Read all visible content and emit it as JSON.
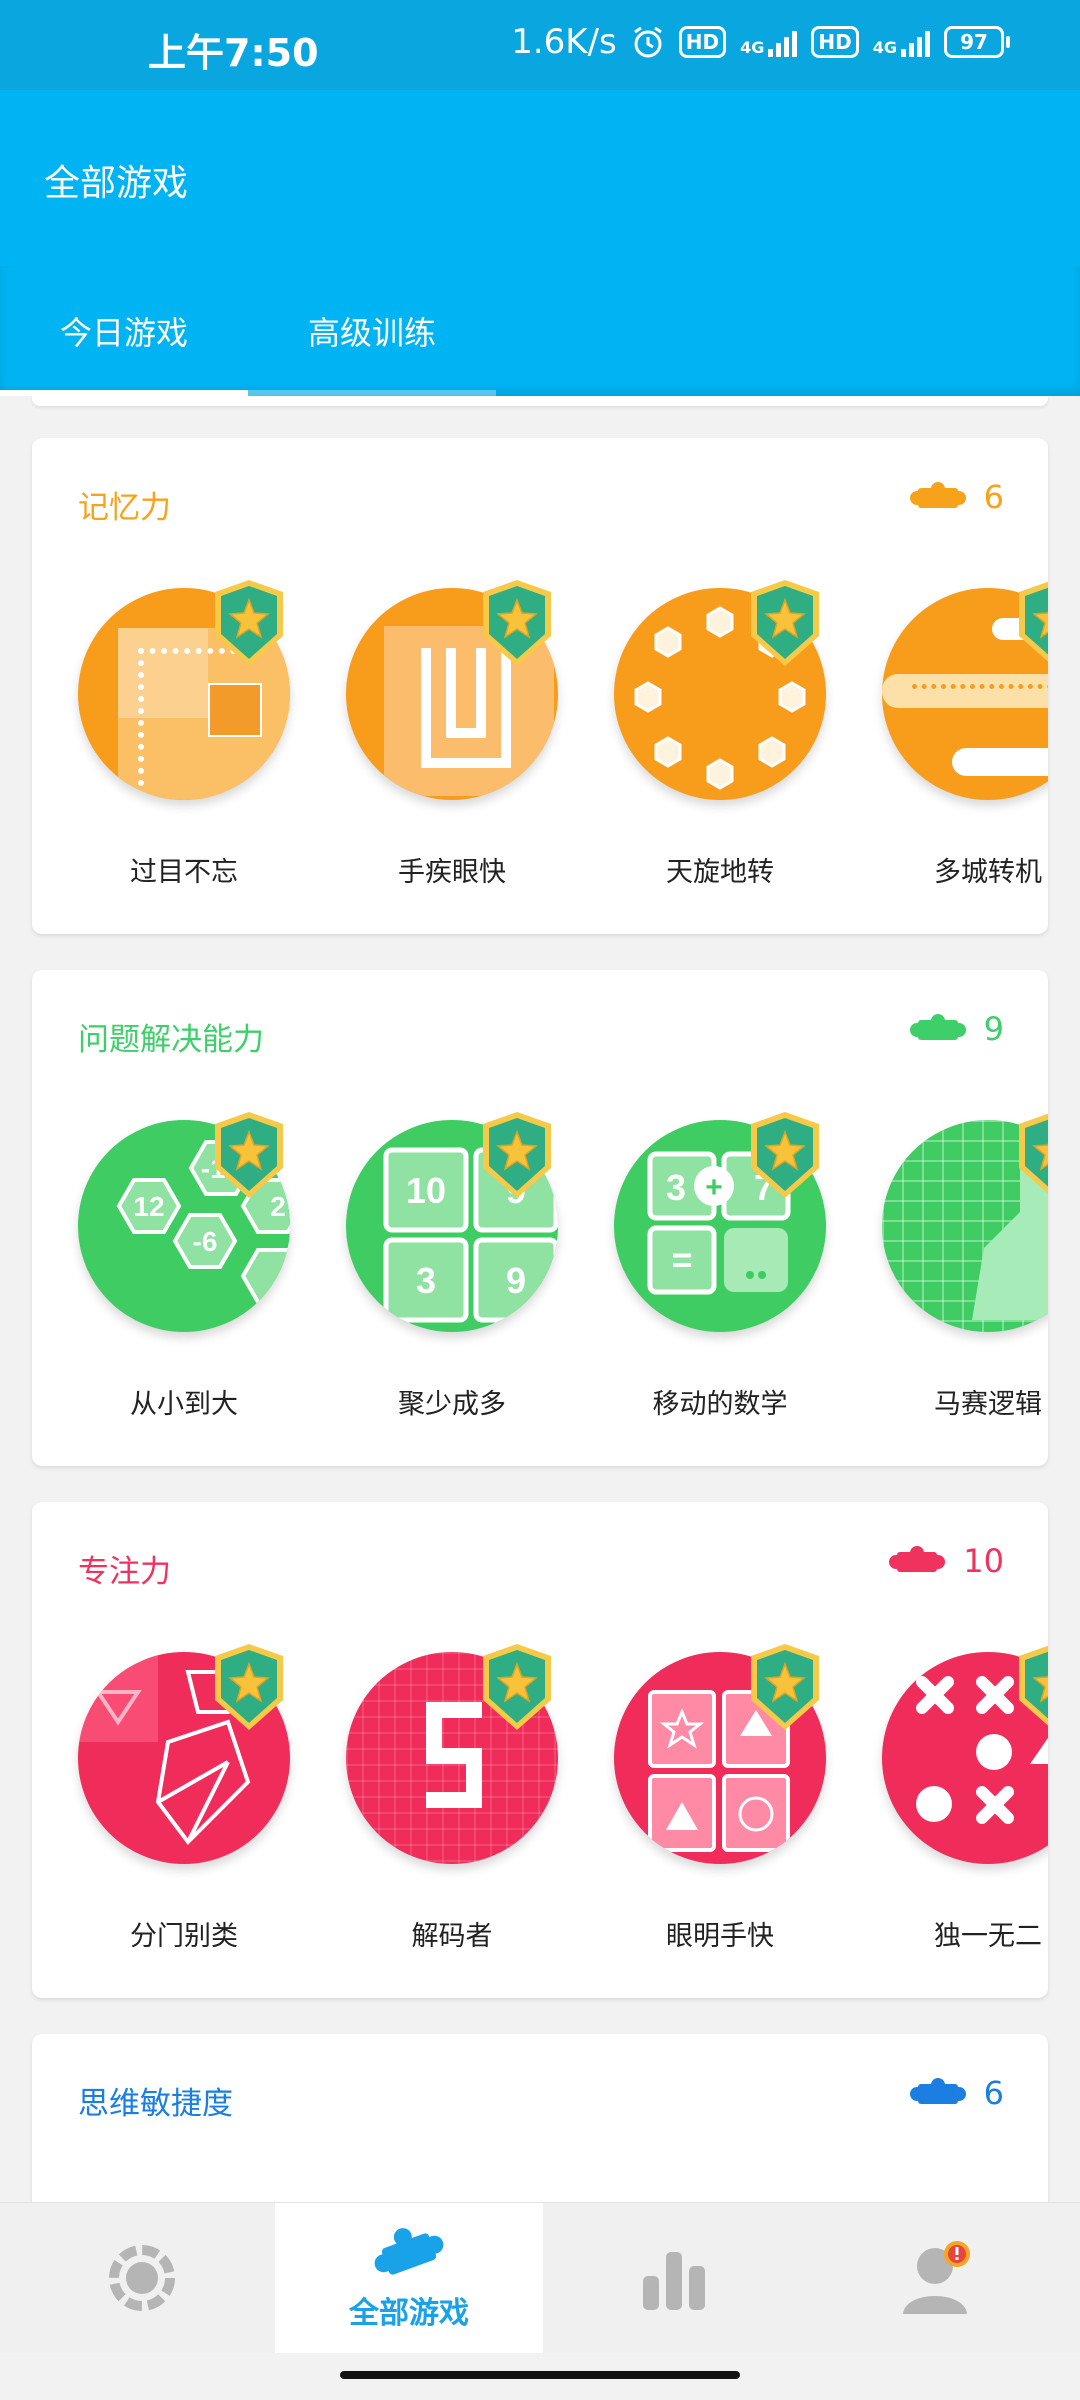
{
  "status_bar": {
    "time": "上午7:50",
    "speed": "1.6K/s",
    "hd1": "HD",
    "net1": "4G",
    "hd2": "HD",
    "net2": "4G",
    "battery": "97"
  },
  "appbar": {
    "title": "全部游戏"
  },
  "tabs": [
    {
      "label": "今日游戏",
      "active": true
    },
    {
      "label": "高级训练",
      "active": false
    }
  ],
  "sections": [
    {
      "title": "记忆力",
      "count": "6",
      "color": "#f7a21b",
      "games": [
        {
          "label": "过目不忘",
          "icon": "grid-path-icon"
        },
        {
          "label": "手疾眼快",
          "icon": "u-shape-grid-icon"
        },
        {
          "label": "天旋地转",
          "icon": "hexagon-ring-icon"
        },
        {
          "label": "多城转机",
          "icon": "airplane-clouds-icon"
        }
      ]
    },
    {
      "title": "问题解决能力",
      "count": "9",
      "color": "#3ecf6a",
      "games": [
        {
          "label": "从小到大",
          "icon": "number-hexagons-icon",
          "nums": [
            "12",
            "-12",
            "-6",
            "2"
          ]
        },
        {
          "label": "聚少成多",
          "icon": "number-tiles-icon",
          "nums": [
            "10",
            "3",
            "9",
            "9"
          ]
        },
        {
          "label": "移动的数学",
          "icon": "math-tiles-icon",
          "nums": [
            "3",
            "+",
            "7",
            "="
          ]
        },
        {
          "label": "马赛逻辑",
          "icon": "mosaic-grid-icon"
        }
      ]
    },
    {
      "title": "专注力",
      "count": "10",
      "color": "#f0325e",
      "games": [
        {
          "label": "分门别类",
          "icon": "origami-crane-icon"
        },
        {
          "label": "解码者",
          "icon": "pixel-digit-icon"
        },
        {
          "label": "眼明手快",
          "icon": "shape-cards-icon"
        },
        {
          "label": "独一无二",
          "icon": "x-and-circle-icon"
        }
      ]
    },
    {
      "title": "思维敏捷度",
      "count": "6",
      "color": "#1a7fe0"
    }
  ],
  "bottom_nav": [
    {
      "name": "nav-home",
      "icon": "ring-icon",
      "label": ""
    },
    {
      "name": "nav-all-games",
      "icon": "puzzle-icon",
      "label": "全部游戏",
      "active": true
    },
    {
      "name": "nav-stats",
      "icon": "bar-chart-icon",
      "label": ""
    },
    {
      "name": "nav-profile",
      "icon": "person-alert-icon",
      "label": ""
    }
  ]
}
